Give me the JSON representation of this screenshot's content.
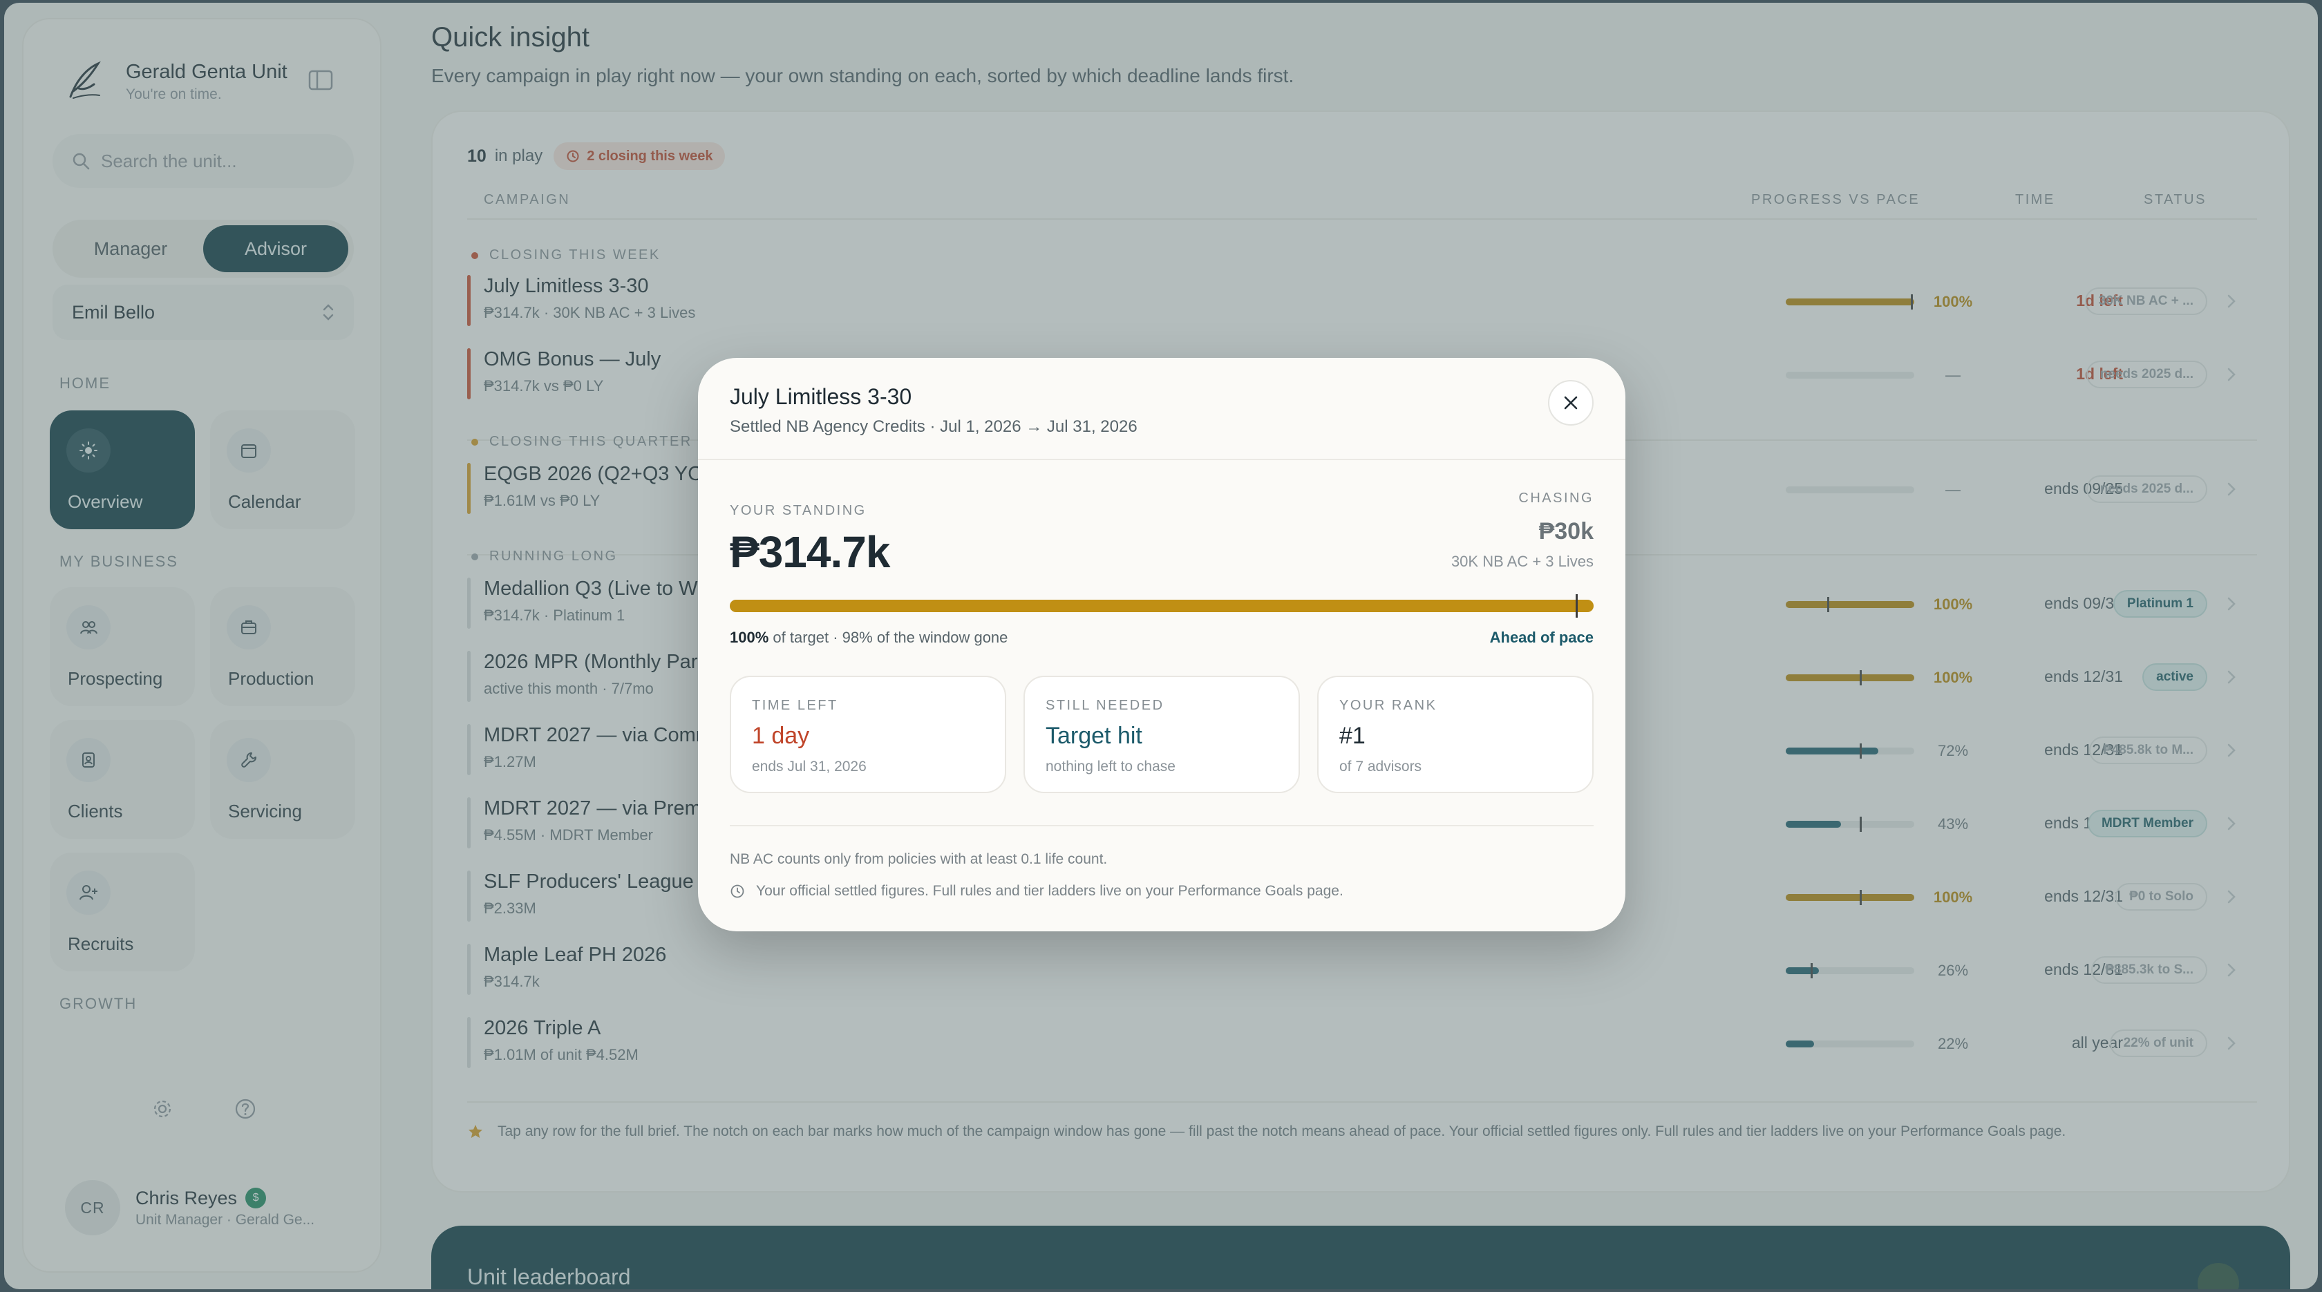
{
  "brand": {
    "name": "Gerald Genta Unit",
    "subtitle": "You're on time."
  },
  "search": {
    "placeholder": "Search the unit..."
  },
  "role_toggle": {
    "options": [
      "Manager",
      "Advisor"
    ],
    "selected": "Advisor"
  },
  "person_select": {
    "value": "Emil Bello"
  },
  "nav": {
    "home_label": "HOME",
    "business_label": "MY BUSINESS",
    "growth_label": "GROWTH",
    "items": [
      {
        "label": "Overview",
        "icon": "sun-icon"
      },
      {
        "label": "Calendar",
        "icon": "calendar-icon"
      },
      {
        "label": "Prospecting",
        "icon": "people-icon"
      },
      {
        "label": "Production",
        "icon": "briefcase-icon"
      },
      {
        "label": "Clients",
        "icon": "contact-icon"
      },
      {
        "label": "Servicing",
        "icon": "wrench-icon"
      },
      {
        "label": "Recruits",
        "icon": "add-user-icon"
      }
    ]
  },
  "user": {
    "initials": "CR",
    "name": "Chris Reyes",
    "badge": "$",
    "role": "Unit Manager · Gerald Ge..."
  },
  "main": {
    "title": "Quick insight",
    "subtitle": "Every campaign in play right now — your own standing on each, sorted by which deadline lands first.",
    "count": "10",
    "count_label": "in play",
    "closing_pill": "2 closing this week",
    "columns": {
      "campaign": "CAMPAIGN",
      "progress": "PROGRESS VS PACE",
      "time": "TIME",
      "status": "STATUS"
    },
    "groups": {
      "week": "CLOSING THIS WEEK",
      "quarter": "CLOSING THIS QUARTER",
      "long": "RUNNING LONG"
    },
    "rows": [
      {
        "name": "July Limitless 3-30",
        "meta": "₱314.7k · 30K NB AC + 3 Lives",
        "progress": 1.0,
        "pace": 0.98,
        "pct": "100%",
        "time": "1d left",
        "status": "30K NB AC + ...",
        "accent": "#c94a2c",
        "bar": "#b8860b"
      },
      {
        "name": "OMG Bonus — July",
        "meta": "₱314.7k vs ₱0 LY",
        "progress": 0,
        "pace": null,
        "pct": "—",
        "time": "1d left",
        "status": "needs 2025 d...",
        "accent": "#c94a2c",
        "bar": "#b8860b"
      },
      {
        "name": "EQGB 2026 (Q2+Q3 YOY)",
        "meta": "₱1.61M vs ₱0 LY",
        "progress": 0,
        "pace": null,
        "pct": "—",
        "time": "ends 09/25",
        "status": "needs 2025 d...",
        "accent": "#d79a20",
        "bar": "#b8860b"
      },
      {
        "name": "Medallion Q3 (Live to Win)",
        "meta": "₱314.7k · Platinum 1",
        "progress": 1.0,
        "pace": 0.33,
        "pct": "100%",
        "time": "ends 09/30",
        "status": "Platinum 1",
        "accent": "#d6d9d9",
        "bar": "#b8860b",
        "strong": true
      },
      {
        "name": "2026 MPR (Monthly Participation)",
        "meta": "active this month · 7/7mo",
        "progress": 1.0,
        "pace": 0.58,
        "pct": "100%",
        "time": "ends 12/31",
        "status": "active",
        "accent": "#d6d9d9",
        "bar": "#b8860b",
        "strong": true
      },
      {
        "name": "MDRT 2027 — via Commission",
        "meta": "₱1.27M",
        "progress": 0.72,
        "pace": 0.58,
        "pct": "72%",
        "time": "ends 12/31",
        "status": "₱485.8k to M...",
        "accent": "#d6d9d9",
        "bar": "#1d5d6b"
      },
      {
        "name": "MDRT 2027 — via Premium",
        "meta": "₱4.55M · MDRT Member",
        "progress": 0.43,
        "pace": 0.58,
        "pct": "43%",
        "time": "ends 12/31",
        "status": "MDRT Member",
        "accent": "#d6d9d9",
        "bar": "#1d5d6b",
        "strong": true
      },
      {
        "name": "SLF Producers' League 2026",
        "meta": "₱2.33M",
        "progress": 1.0,
        "pace": 0.58,
        "pct": "100%",
        "time": "ends 12/31",
        "status": "₱0 to Solo",
        "accent": "#d6d9d9",
        "bar": "#b8860b"
      },
      {
        "name": "Maple Leaf PH 2026",
        "meta": "₱314.7k",
        "progress": 0.26,
        "pace": 0.2,
        "pct": "26%",
        "time": "ends 12/31",
        "status": "₱885.3k to S...",
        "accent": "#d6d9d9",
        "bar": "#1d5d6b"
      },
      {
        "name": "2026 Triple A",
        "meta": "₱1.01M of unit ₱4.52M",
        "progress": 0.22,
        "pace": null,
        "pct": "22%",
        "time": "all year",
        "status": "22% of unit",
        "accent": "#d6d9d9",
        "bar": "#1d5d6b"
      }
    ],
    "footnote": "Tap any row for the full brief. The notch on each bar marks how much of the campaign window has gone — fill past the notch means ahead of pace. Your official settled figures only. Full rules and tier ladders live on your Performance Goals page."
  },
  "leaderboard": {
    "title": "Unit leaderboard"
  },
  "modal": {
    "title": "July Limitless 3-30",
    "subtitle": "Settled NB Agency Credits · Jul 1, 2026 → Jul 31, 2026",
    "standing_label": "YOUR STANDING",
    "standing_value": "₱314.7k",
    "chasing_label": "CHASING",
    "chasing_value": "₱30k",
    "chasing_sub": "30K NB AC + 3 Lives",
    "progress": 1.0,
    "pace": 0.98,
    "caption_pct": "100%",
    "caption_rest": "of target · 98% of the window gone",
    "pace_status": "Ahead of pace",
    "cards": [
      {
        "label": "TIME LEFT",
        "value": "1 day",
        "sub": "ends Jul 31, 2026",
        "color": "#c0452a"
      },
      {
        "label": "STILL NEEDED",
        "value": "Target hit",
        "sub": "nothing left to chase",
        "color": "#1c5a6a"
      },
      {
        "label": "YOUR RANK",
        "value": "#1",
        "sub": "of 7 advisors",
        "color": "#1f2b33"
      }
    ],
    "note1": "NB AC counts only from policies with at least 0.1 life count.",
    "note2": "Your official settled figures. Full rules and tier ladders live on your Performance Goals page."
  }
}
